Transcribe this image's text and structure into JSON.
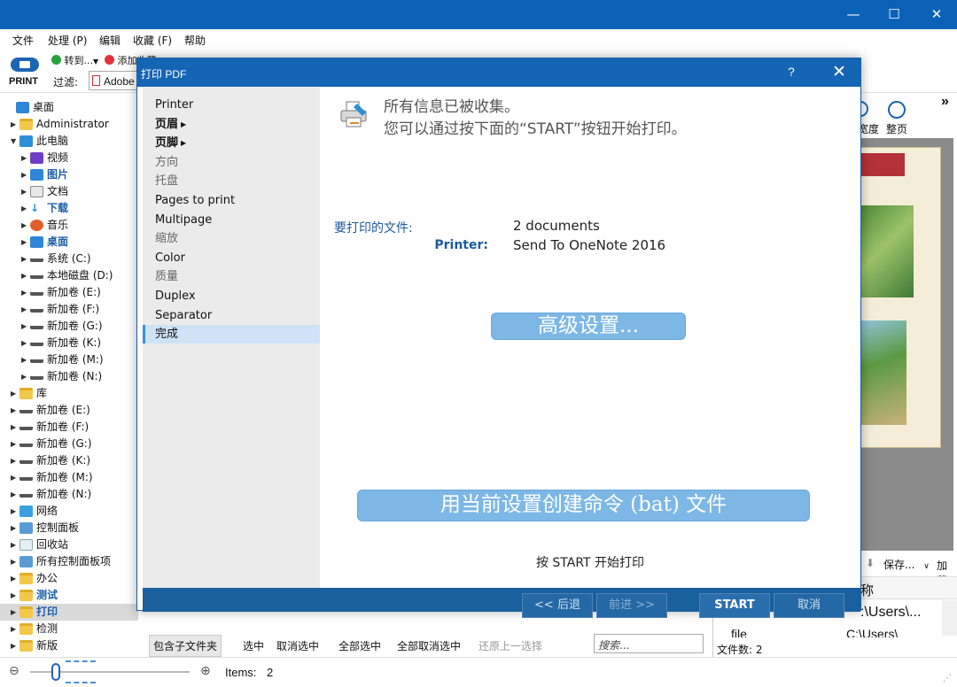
{
  "window": {
    "minimize_glyph": "—",
    "maximize_glyph": "☐",
    "close_glyph": "✕"
  },
  "menu": [
    "文件",
    "处理 (P)",
    "编辑",
    "收藏 (F)",
    "帮助"
  ],
  "toolbar": {
    "print_label": "PRINT",
    "goto_label": "转到...",
    "add_fav_label": "添加收藏",
    "filter_label": "过滤:",
    "filter_value": "Adobe A"
  },
  "tree": [
    {
      "label": "桌面",
      "icon": "desktop",
      "indent": 0,
      "arrow": ""
    },
    {
      "label": "Administrator",
      "icon": "folder",
      "indent": 1,
      "arrow": "▶"
    },
    {
      "label": "此电脑",
      "icon": "pc",
      "indent": 1,
      "arrow": "▼"
    },
    {
      "label": "视频",
      "icon": "purple",
      "indent": 2,
      "arrow": "▶"
    },
    {
      "label": "图片",
      "icon": "blue",
      "indent": 2,
      "arrow": "▶",
      "bold": true
    },
    {
      "label": "文档",
      "icon": "doc",
      "indent": 2,
      "arrow": "▶"
    },
    {
      "label": "下载",
      "icon": "down",
      "indent": 2,
      "arrow": "▶",
      "bold": true
    },
    {
      "label": "音乐",
      "icon": "music",
      "indent": 2,
      "arrow": "▶"
    },
    {
      "label": "桌面",
      "icon": "blue",
      "indent": 2,
      "arrow": "▶",
      "bold": true
    },
    {
      "label": "系统 (C:)",
      "icon": "drive",
      "indent": 2,
      "arrow": "▶"
    },
    {
      "label": "本地磁盘 (D:)",
      "icon": "drive",
      "indent": 2,
      "arrow": "▶"
    },
    {
      "label": "新加卷 (E:)",
      "icon": "drive",
      "indent": 2,
      "arrow": "▶"
    },
    {
      "label": "新加卷 (F:)",
      "icon": "drive",
      "indent": 2,
      "arrow": "▶"
    },
    {
      "label": "新加卷 (G:)",
      "icon": "drive",
      "indent": 2,
      "arrow": "▶"
    },
    {
      "label": "新加卷 (K:)",
      "icon": "drive",
      "indent": 2,
      "arrow": "▶"
    },
    {
      "label": "新加卷 (M:)",
      "icon": "drive",
      "indent": 2,
      "arrow": "▶"
    },
    {
      "label": "新加卷 (N:)",
      "icon": "drive",
      "indent": 2,
      "arrow": "▶"
    },
    {
      "label": "库",
      "icon": "folder",
      "indent": 1,
      "arrow": "▶"
    },
    {
      "label": "新加卷 (E:)",
      "icon": "drive",
      "indent": 1,
      "arrow": "▶"
    },
    {
      "label": "新加卷 (F:)",
      "icon": "drive",
      "indent": 1,
      "arrow": "▶"
    },
    {
      "label": "新加卷 (G:)",
      "icon": "drive",
      "indent": 1,
      "arrow": "▶"
    },
    {
      "label": "新加卷 (K:)",
      "icon": "drive",
      "indent": 1,
      "arrow": "▶"
    },
    {
      "label": "新加卷 (M:)",
      "icon": "drive",
      "indent": 1,
      "arrow": "▶"
    },
    {
      "label": "新加卷 (N:)",
      "icon": "drive",
      "indent": 1,
      "arrow": "▶"
    },
    {
      "label": "网络",
      "icon": "net",
      "indent": 1,
      "arrow": "▶"
    },
    {
      "label": "控制面板",
      "icon": "cp",
      "indent": 1,
      "arrow": "▶"
    },
    {
      "label": "回收站",
      "icon": "rb",
      "indent": 1,
      "arrow": "▶"
    },
    {
      "label": "所有控制面板项",
      "icon": "cp",
      "indent": 1,
      "arrow": "▶"
    },
    {
      "label": "办公",
      "icon": "folder",
      "indent": 1,
      "arrow": "▶"
    },
    {
      "label": "测试",
      "icon": "folder",
      "indent": 1,
      "arrow": "▶",
      "bold": true
    },
    {
      "label": "打印",
      "icon": "folder",
      "indent": 1,
      "arrow": "▶",
      "bold": true,
      "selected": true
    },
    {
      "label": "检测",
      "icon": "folder",
      "indent": 1,
      "arrow": "▶"
    },
    {
      "label": "新版",
      "icon": "folder",
      "indent": 1,
      "arrow": "▶"
    }
  ],
  "status": {
    "items_label": "Items:",
    "items_count": "2",
    "zoom_out": "⊖",
    "zoom_in": "⊕"
  },
  "mid_bottom": {
    "include_sub": "包含子文件夹",
    "select": "选中",
    "deselect": "取消选中",
    "select_all": "全部选中",
    "deselect_all": "全部取消选中",
    "restore": "还原上一选择",
    "search_placeholder": "搜索..."
  },
  "right_panel": {
    "width_label": "宽度",
    "full_page_label": "整页",
    "more_glyph": "»",
    "save_label": "保存...",
    "add_label": "加载",
    "col_name": "称",
    "path1": ":\\Users\\...",
    "row2": "file",
    "path2": "C:\\Users\\",
    "file_count": "文件数: 2"
  },
  "dialog": {
    "title": "打印 PDF",
    "help": "?",
    "close": "✕",
    "nav": [
      {
        "label": "Printer",
        "style": "normal"
      },
      {
        "label": "页眉",
        "style": "bold",
        "caret": true
      },
      {
        "label": "页脚",
        "style": "bold",
        "caret": true
      },
      {
        "label": "方向",
        "style": "dim"
      },
      {
        "label": "托盘",
        "style": "dim"
      },
      {
        "label": "Pages to print",
        "style": "normal"
      },
      {
        "label": "Multipage",
        "style": "normal"
      },
      {
        "label": "缩放",
        "style": "dim"
      },
      {
        "label": "Color",
        "style": "normal"
      },
      {
        "label": "质量",
        "style": "dim"
      },
      {
        "label": "Duplex",
        "style": "normal"
      },
      {
        "label": "Separator",
        "style": "normal"
      },
      {
        "label": "完成",
        "style": "active"
      }
    ],
    "message_line1": "所有信息已被收集。",
    "message_line2": "您可以通过按下面的“START”按钮开始打印。",
    "files_key": "要打印的文件:",
    "files_value": "2 documents",
    "printer_key": "Printer:",
    "printer_value": "Send To OneNote 2016",
    "advanced_btn": "高级设置...",
    "bat_btn": "用当前设置创建命令 (bat) 文件",
    "start_hint": "按 START 开始打印",
    "back_btn": "<< 后退",
    "next_btn": "前进 >>",
    "start_btn": "START",
    "cancel_btn": "取消"
  }
}
